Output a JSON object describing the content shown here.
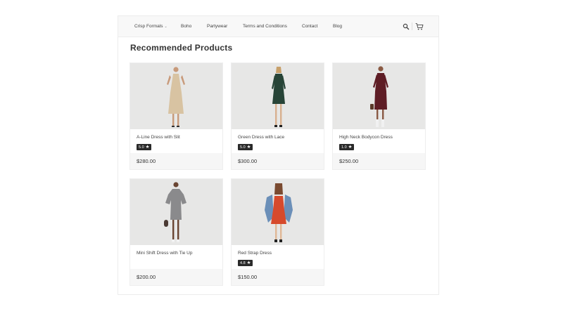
{
  "nav": {
    "items": [
      {
        "label": "Crisp Formals",
        "has_dropdown": true
      },
      {
        "label": "Boho"
      },
      {
        "label": "Partywear"
      },
      {
        "label": "Terms and Conditions"
      },
      {
        "label": "Contact"
      },
      {
        "label": "Blog"
      }
    ],
    "icons": [
      "search-icon",
      "cart-icon"
    ]
  },
  "section": {
    "title": "Recommended Products"
  },
  "products": [
    {
      "name": "A-Line Dress with Slit",
      "rating": "5.0",
      "price": "$280.00",
      "dress_color": "#d8c3a2"
    },
    {
      "name": "Green Dress with Lace",
      "rating": "5.0",
      "price": "$300.00",
      "dress_color": "#274437"
    },
    {
      "name": "High Neck Bodycon Dress",
      "rating": "1.0",
      "price": "$250.00",
      "dress_color": "#5e1d25"
    },
    {
      "name": "Mini Shift Dress with Tie Up",
      "rating": "",
      "price": "$200.00",
      "dress_color": "#8a8a8c"
    },
    {
      "name": "Red Strap Dress",
      "rating": "4.8",
      "price": "$150.00",
      "dress_color": "#d64a2c"
    }
  ],
  "colors": {
    "rating_badge": "#2a2a2a",
    "card_footer": "#f6f6f6",
    "image_bg": "#e7e7e6"
  }
}
